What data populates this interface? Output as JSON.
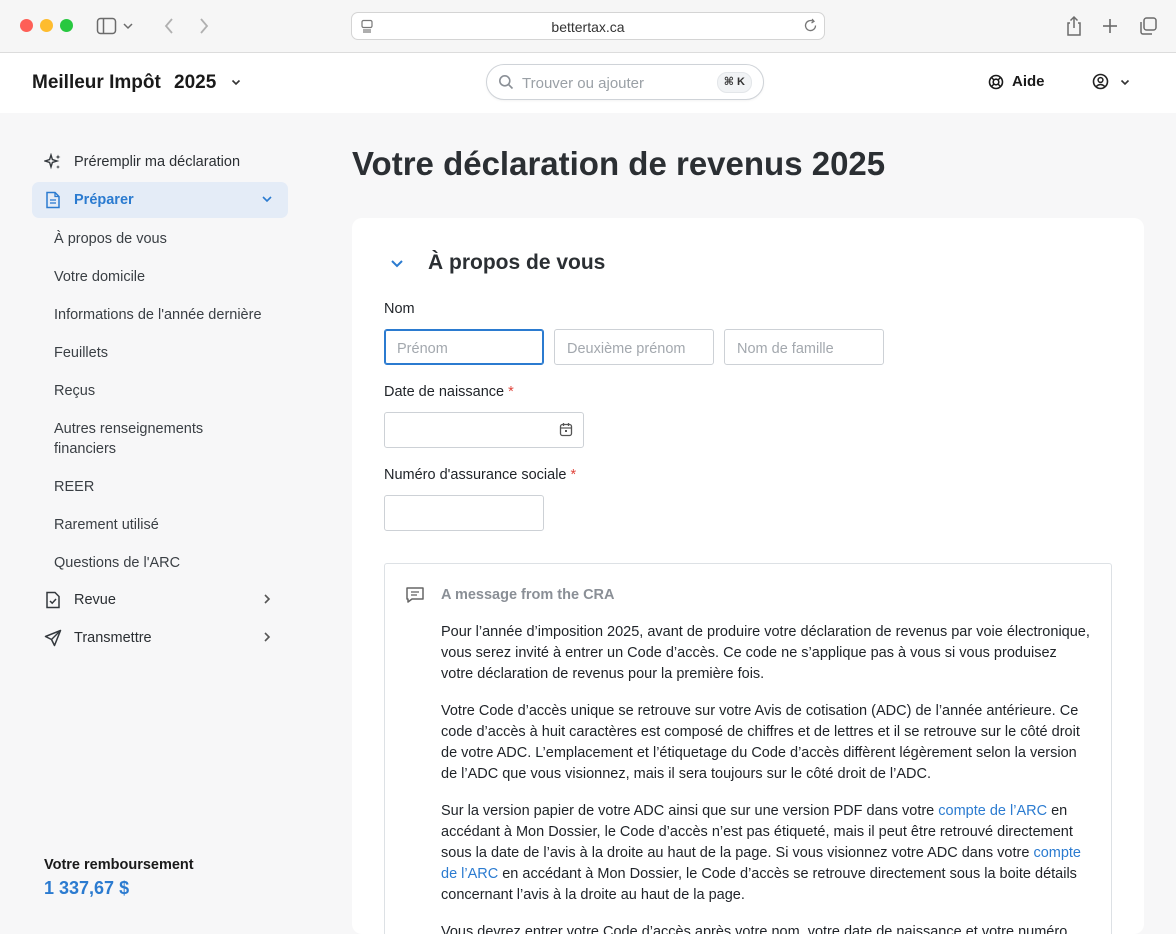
{
  "browser": {
    "url": "bettertax.ca"
  },
  "header": {
    "brand": "Meilleur Impôt",
    "year": "2025",
    "search_placeholder": "Trouver ou ajouter",
    "search_shortcut": "⌘ K",
    "help_label": "Aide"
  },
  "sidebar": {
    "prefill": "Préremplir ma déclaration",
    "prepare": "Préparer",
    "sub_items": [
      "À propos de vous",
      "Votre domicile",
      "Informations de l'année dernière",
      "Feuillets",
      "Reçus",
      "Autres renseignements financiers",
      "REER",
      "Rarement utilisé",
      "Questions de l'ARC"
    ],
    "review": "Revue",
    "transmit": "Transmettre",
    "refund_label": "Votre remboursement",
    "refund_value": "1 337,67 $"
  },
  "main": {
    "page_title": "Votre déclaration de revenus 2025",
    "section_title": "À propos de vous",
    "name_label": "Nom",
    "first_name_ph": "Prénom",
    "middle_name_ph": "Deuxième prénom",
    "last_name_ph": "Nom de famille",
    "dob_label": "Date de naissance",
    "sin_label": "Numéro d'assurance sociale",
    "required_mark": "*",
    "message": {
      "title": "A message from the CRA",
      "p1": "Pour l’année d’imposition 2025, avant de produire votre déclaration de revenus par voie électronique, vous serez invité à entrer un Code d’accès. Ce code ne s’applique pas à vous si vous produisez votre déclaration de revenus pour la première fois.",
      "p2": "Votre Code d’accès unique se retrouve sur votre Avis de cotisation (ADC) de l’année antérieure. Ce code d’accès à huit caractères est composé de chiffres et de lettres et il se retrouve sur le côté droit de votre ADC. L’emplacement et l’étiquetage du Code d’accès diffèrent légèrement selon la version de l’ADC que vous visionnez, mais il sera toujours sur le côté droit de l’ADC.",
      "p3_a": "Sur la version papier de votre ADC ainsi que sur une version PDF dans votre ",
      "p3_link1": "compte de l’ARC",
      "p3_b": " en accédant à Mon Dossier, le Code d’accès n’est pas étiqueté, mais il peut être retrouvé directement sous la date de l’avis à la droite au haut de la page. Si vous visionnez votre ADC dans votre ",
      "p3_link2": "compte de l’ARC",
      "p3_c": " en accédant à Mon Dossier, le Code d’accès se retrouve directement sous la boite détails concernant l’avis à la droite au haut de la page.",
      "p4": "Vous devrez entrer votre Code d’accès après votre nom, votre date de naissance et votre numéro"
    }
  }
}
